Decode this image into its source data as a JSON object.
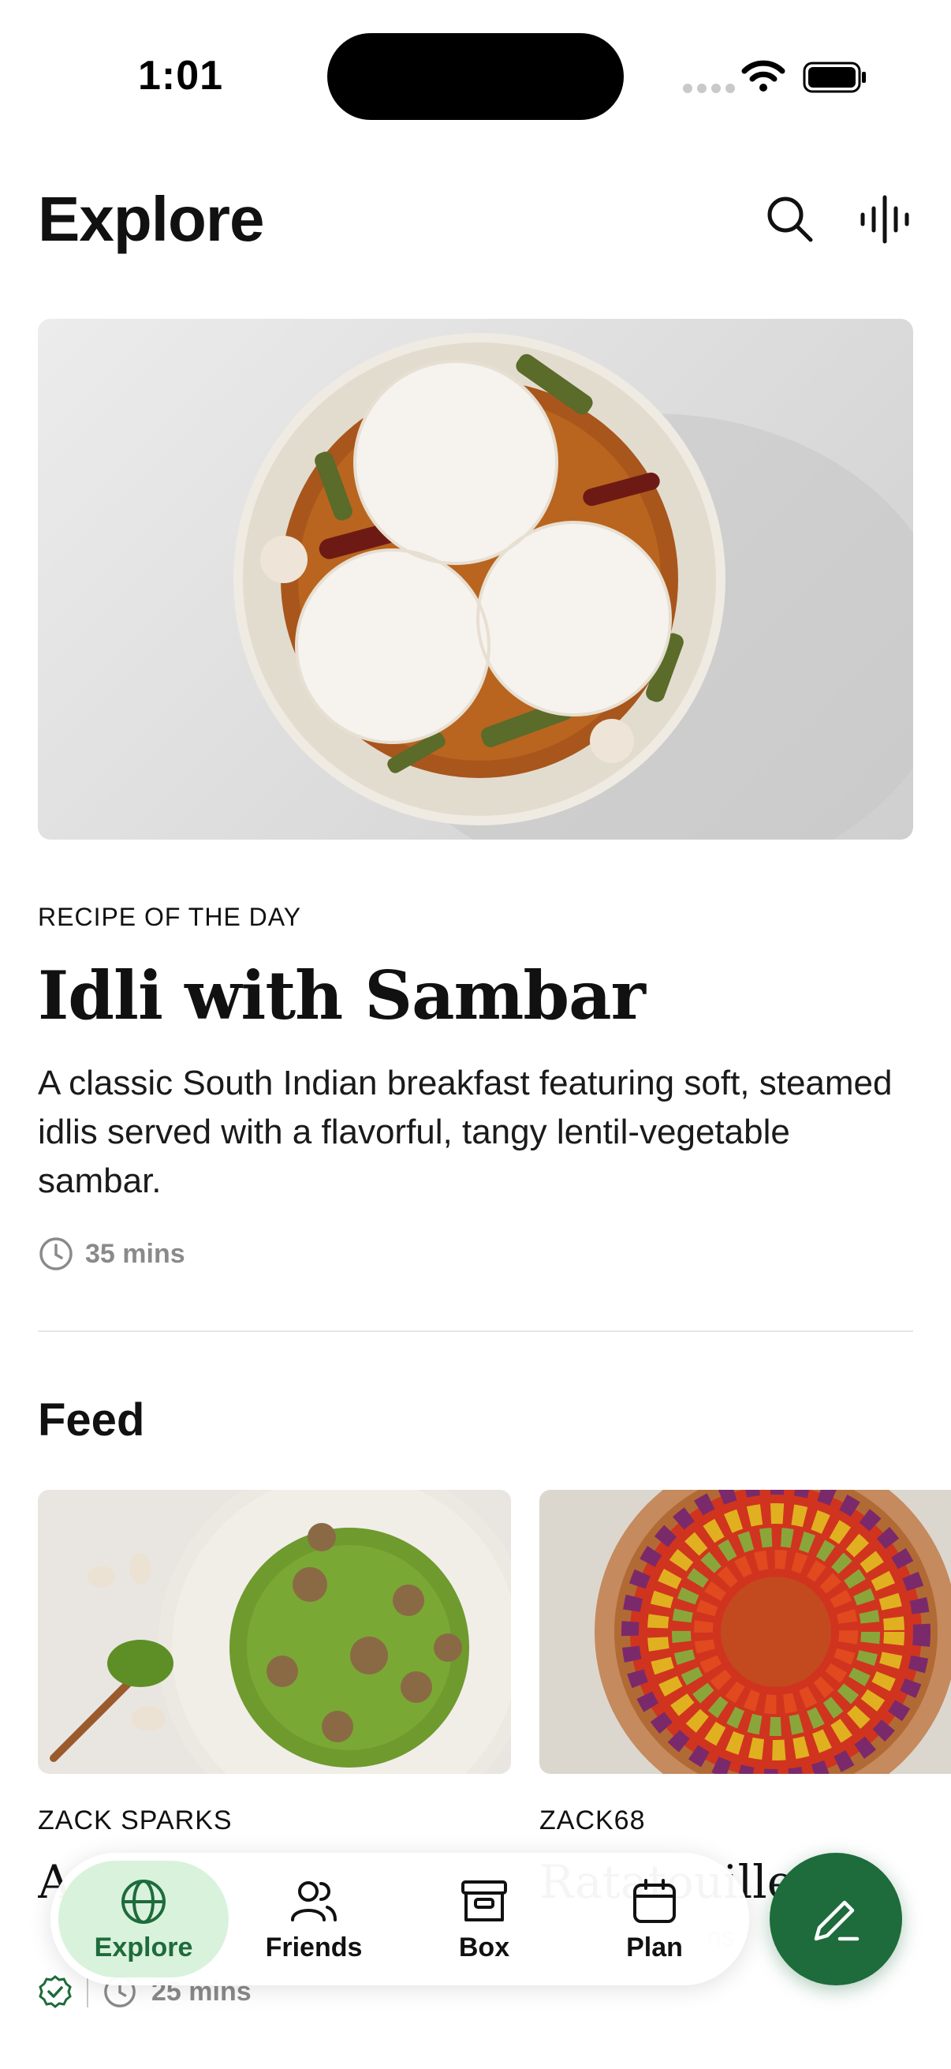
{
  "status_bar": {
    "time": "1:01"
  },
  "header": {
    "title": "Explore",
    "search_icon": "search-icon",
    "voice_icon": "voice-waveform-icon"
  },
  "hero": {
    "label": "RECIPE OF THE DAY",
    "title": "Idli with Sambar",
    "description": "A classic South Indian breakfast featuring soft, steamed idlis served with a flavorful, tangy lentil-vegetable sambar.",
    "time": "35 mins"
  },
  "feed": {
    "heading": "Feed",
    "cards": [
      {
        "author": "ZACK SPARKS",
        "title": "A",
        "time": "25 mins"
      },
      {
        "author": "ZACK68",
        "title": "Ratatouille",
        "time": "ns"
      }
    ]
  },
  "nav": {
    "items": [
      {
        "label": "Explore",
        "icon": "globe-icon"
      },
      {
        "label": "Friends",
        "icon": "users-icon"
      },
      {
        "label": "Box",
        "icon": "archive-box-icon"
      },
      {
        "label": "Plan",
        "icon": "calendar-icon"
      }
    ]
  },
  "colors": {
    "accent": "#1e6b3c",
    "accent_light": "#d9f2dc",
    "muted": "#8a8a8a"
  }
}
